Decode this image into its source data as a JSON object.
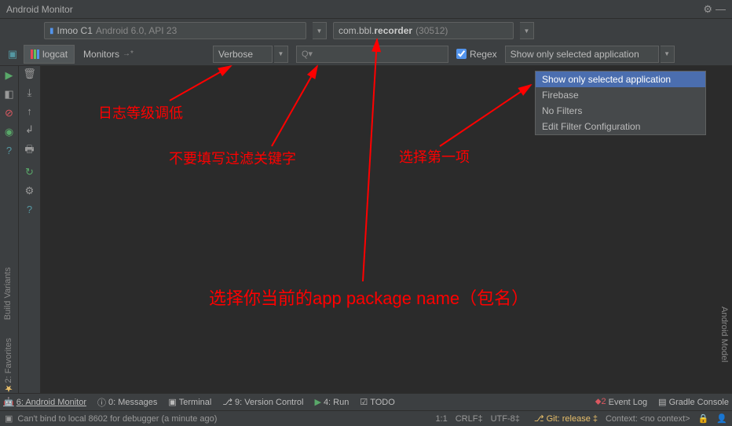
{
  "title": "Android Monitor",
  "device": {
    "name": "Imoo C1",
    "os": "Android 6.0, API 23"
  },
  "process": {
    "pkg_prefix": "com.bbl.",
    "pkg_bold": "recorder",
    "pid": "(30512)"
  },
  "tabs": {
    "logcat": "logcat",
    "monitors": "Monitors"
  },
  "log_level": "Verbose",
  "regex_label": "Regex",
  "filter_selected": "Show only selected application",
  "filter_options": [
    "Show only selected application",
    "Firebase",
    "No Filters",
    "Edit Filter Configuration"
  ],
  "annotations": {
    "level": "日志等级调低",
    "search": "不要填写过滤关键字",
    "select": "选择第一项",
    "package": "选择你当前的app package name（包名）"
  },
  "side_labels": {
    "build": "Build Variants",
    "fav": "2: Favorites",
    "model": "Android Model"
  },
  "bottom": {
    "monitor": "6: Android Monitor",
    "messages": "0: Messages",
    "terminal": "Terminal",
    "vcs": "9: Version Control",
    "run": "4: Run",
    "todo": "TODO",
    "event": "Event Log",
    "gradle": "Gradle Console"
  },
  "status": {
    "message": "Can't bind to local 8602 for debugger (a minute ago)",
    "pos": "1:1",
    "lineend": "CRLF",
    "encoding": "UTF-8",
    "git": "Git: release",
    "context": "Context: <no context>"
  }
}
